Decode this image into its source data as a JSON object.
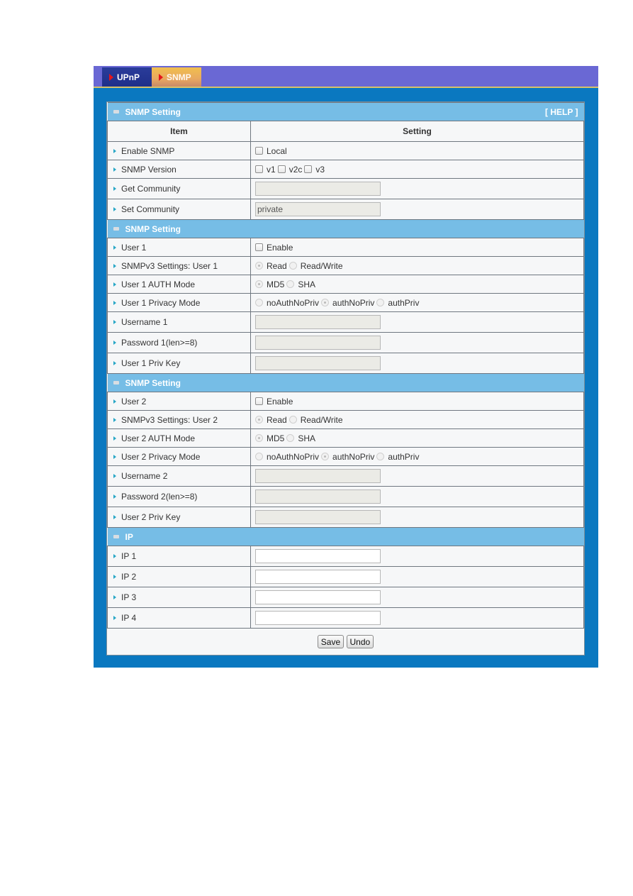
{
  "tabs": [
    {
      "label": "UPnP",
      "active": false
    },
    {
      "label": "SNMP",
      "active": true
    }
  ],
  "help_label": "[ HELP ]",
  "table_header": {
    "item": "Item",
    "setting": "Setting"
  },
  "sections": [
    {
      "title": "SNMP Setting",
      "rows": [
        {
          "label": "Enable SNMP",
          "type": "checkbox",
          "options": [
            {
              "label": "Local",
              "checked": false
            }
          ]
        },
        {
          "label": "SNMP Version",
          "type": "checkbox",
          "options": [
            {
              "label": "v1",
              "checked": false
            },
            {
              "label": "v2c",
              "checked": false
            },
            {
              "label": "v3",
              "checked": false
            }
          ]
        },
        {
          "label": "Get Community",
          "type": "text",
          "value": "",
          "disabled": true
        },
        {
          "label": "Set Community",
          "type": "text",
          "value": "private",
          "disabled": true
        }
      ]
    },
    {
      "title": "SNMP Setting",
      "rows": [
        {
          "label": "User 1",
          "type": "checkbox",
          "options": [
            {
              "label": "Enable",
              "checked": false
            }
          ]
        },
        {
          "label": "SNMPv3 Settings: User 1",
          "type": "radio",
          "options": [
            {
              "label": "Read",
              "checked": true
            },
            {
              "label": "Read/Write",
              "checked": false
            }
          ]
        },
        {
          "label": "User 1 AUTH Mode",
          "type": "radio",
          "options": [
            {
              "label": "MD5",
              "checked": true
            },
            {
              "label": "SHA",
              "checked": false
            }
          ]
        },
        {
          "label": "User 1 Privacy Mode",
          "type": "radio",
          "options": [
            {
              "label": "noAuthNoPriv",
              "checked": false
            },
            {
              "label": "authNoPriv",
              "checked": true
            },
            {
              "label": "authPriv",
              "checked": false
            }
          ]
        },
        {
          "label": "Username 1",
          "type": "text",
          "value": "",
          "disabled": true
        },
        {
          "label": "Password 1(len>=8)",
          "type": "text",
          "value": "",
          "disabled": true
        },
        {
          "label": "User 1 Priv Key",
          "type": "text",
          "value": "",
          "disabled": true
        }
      ]
    },
    {
      "title": "SNMP Setting",
      "rows": [
        {
          "label": "User 2",
          "type": "checkbox",
          "options": [
            {
              "label": "Enable",
              "checked": false
            }
          ]
        },
        {
          "label": "SNMPv3 Settings: User 2",
          "type": "radio",
          "options": [
            {
              "label": "Read",
              "checked": true
            },
            {
              "label": "Read/Write",
              "checked": false
            }
          ]
        },
        {
          "label": "User 2 AUTH Mode",
          "type": "radio",
          "options": [
            {
              "label": "MD5",
              "checked": true
            },
            {
              "label": "SHA",
              "checked": false
            }
          ]
        },
        {
          "label": "User 2 Privacy Mode",
          "type": "radio",
          "options": [
            {
              "label": "noAuthNoPriv",
              "checked": false
            },
            {
              "label": "authNoPriv",
              "checked": true
            },
            {
              "label": "authPriv",
              "checked": false
            }
          ]
        },
        {
          "label": "Username 2",
          "type": "text",
          "value": "",
          "disabled": true
        },
        {
          "label": "Password 2(len>=8)",
          "type": "text",
          "value": "",
          "disabled": true
        },
        {
          "label": "User 2 Priv Key",
          "type": "text",
          "value": "",
          "disabled": true
        }
      ]
    },
    {
      "title": "IP",
      "rows": [
        {
          "label": "IP 1",
          "type": "text",
          "value": "",
          "disabled": false
        },
        {
          "label": "IP 2",
          "type": "text",
          "value": "",
          "disabled": false
        },
        {
          "label": "IP 3",
          "type": "text",
          "value": "",
          "disabled": false
        },
        {
          "label": "IP 4",
          "type": "text",
          "value": "",
          "disabled": false
        }
      ]
    }
  ],
  "buttons": {
    "save": "Save",
    "undo": "Undo"
  },
  "colors": {
    "topbar": "#6a68d4",
    "frame": "#0a78c0",
    "section_header": "#76bde6",
    "active_tab": "#f1bf4e",
    "inactive_tab": "#2a3c9a",
    "bullet": "#28a7c6"
  }
}
